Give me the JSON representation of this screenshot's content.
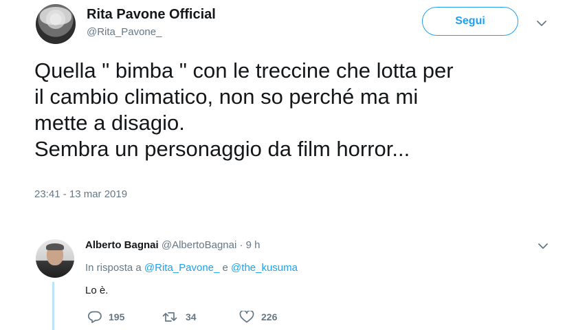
{
  "tweet": {
    "display_name": "Rita Pavone Official",
    "handle": "@Rita_Pavone_",
    "follow_label": "Segui",
    "text": "Quella \" bimba \" con le treccine che lotta per\nil cambio climatico, non so perché  ma mi\nmette a disagio.\nSembra un personaggio da film horror...",
    "timestamp": "23:41 - 13 mar 2019",
    "menu_icon": "chevron-down-icon",
    "avatar_icon": "avatar"
  },
  "reply": {
    "display_name": "Alberto Bagnai",
    "handle": "@AlbertoBagnai",
    "separator": " · ",
    "age": "9 h",
    "in_reply_prefix": "In risposta a",
    "mention_1": "@Rita_Pavone_",
    "mention_joiner": "e",
    "mention_2": "@the_kusuma",
    "text": "Lo è.",
    "counts": {
      "replies": "195",
      "retweets": "34",
      "likes": "226"
    },
    "icons": {
      "reply": "reply-icon",
      "retweet": "retweet-icon",
      "like": "heart-icon"
    }
  },
  "colors": {
    "accent": "#1da1f2",
    "text": "#14171a",
    "secondary": "#657786",
    "thread_line": "#bde3fb"
  }
}
